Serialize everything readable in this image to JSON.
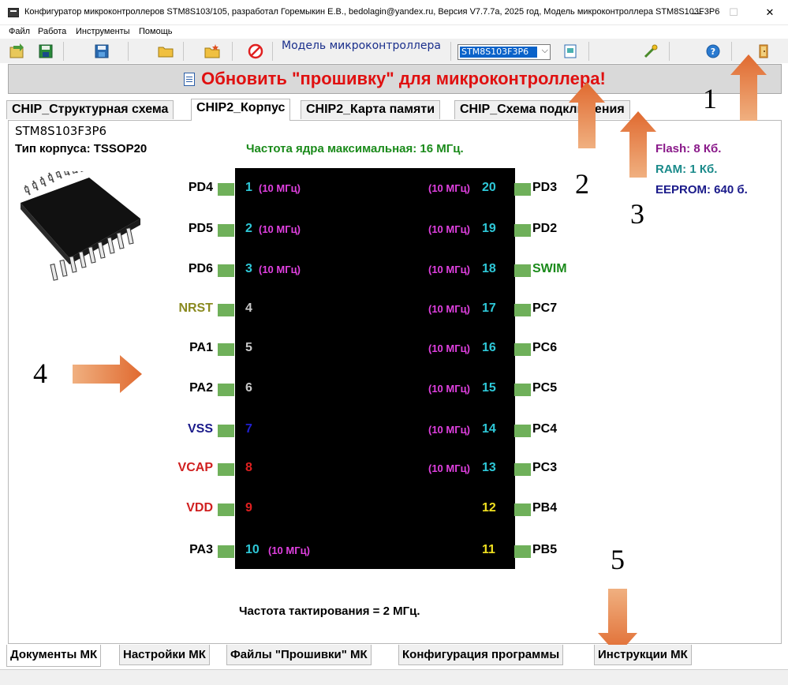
{
  "window": {
    "title": "Конфигуратор микроконтроллеров STM8S103/105, разработал Горемыкин Е.В., bedolagin@yandex.ru, Версия V7.7.7а, 2025 год, Модель микроконтроллера STM8S103F3P6",
    "minimize": "—",
    "maximize": "☐",
    "close": "✕"
  },
  "menu": [
    "Файл",
    "Работа",
    "Инструменты",
    "Помощь"
  ],
  "toolbar": {
    "model_label": "Модель микроконтроллера",
    "model_value": "STM8S103F3P6",
    "model_arrow": "⌵"
  },
  "update_button": "Обновить \"прошивку\" для микроконтроллера!",
  "tabs": [
    "CHIP_Структурная схема",
    "CHIP2_Корпус",
    "CHIP2_Карта памяти",
    "CHIP_Схема подключения"
  ],
  "chip": {
    "name": "STM8S103F3P6",
    "package": "Тип корпуса: TSSOP20",
    "core_freq": "Частота ядра максимальная: 16 МГц.",
    "flash": "Flash: 8 Кб.",
    "ram": "RAM: 1 Кб.",
    "eeprom": "EEPROM: 640 б.",
    "clock": "Частота тактирования = 2 МГц."
  },
  "pins_left": [
    {
      "label": "PD4",
      "num": "1",
      "freq": "(10 МГц)",
      "label_color": "#000000",
      "num_color": "#2ec8d8"
    },
    {
      "label": "PD5",
      "num": "2",
      "freq": "(10 МГц)",
      "label_color": "#000000",
      "num_color": "#2ec8d8"
    },
    {
      "label": "PD6",
      "num": "3",
      "freq": "(10 МГц)",
      "label_color": "#000000",
      "num_color": "#2ec8d8"
    },
    {
      "label": "NRST",
      "num": "4",
      "freq": "",
      "label_color": "#8a8a20",
      "num_color": "#c8c8c8"
    },
    {
      "label": "PA1",
      "num": "5",
      "freq": "",
      "label_color": "#000000",
      "num_color": "#c8c8c8"
    },
    {
      "label": "PA2",
      "num": "6",
      "freq": "",
      "label_color": "#000000",
      "num_color": "#c8c8c8"
    },
    {
      "label": "VSS",
      "num": "7",
      "freq": "",
      "label_color": "#1a1a8a",
      "num_color": "#2020d0"
    },
    {
      "label": "VCAP",
      "num": "8",
      "freq": "",
      "label_color": "#d02020",
      "num_color": "#e02020"
    },
    {
      "label": "VDD",
      "num": "9",
      "freq": "",
      "label_color": "#d02020",
      "num_color": "#e02020"
    },
    {
      "label": "PA3",
      "num": "10",
      "freq": "(10 МГц)",
      "label_color": "#000000",
      "num_color": "#2ec8d8"
    }
  ],
  "pins_right": [
    {
      "label": "PD3",
      "num": "20",
      "freq": "(10 МГц)",
      "label_color": "#000000",
      "num_color": "#2ec8d8"
    },
    {
      "label": "PD2",
      "num": "19",
      "freq": "(10 МГц)",
      "label_color": "#000000",
      "num_color": "#2ec8d8"
    },
    {
      "label": "SWIM",
      "num": "18",
      "freq": "(10 МГц)",
      "label_color": "#1a8a1a",
      "num_color": "#2ec8d8"
    },
    {
      "label": "PC7",
      "num": "17",
      "freq": "(10 МГц)",
      "label_color": "#000000",
      "num_color": "#2ec8d8"
    },
    {
      "label": "PC6",
      "num": "16",
      "freq": "(10 МГц)",
      "label_color": "#000000",
      "num_color": "#2ec8d8"
    },
    {
      "label": "PC5",
      "num": "15",
      "freq": "(10 МГц)",
      "label_color": "#000000",
      "num_color": "#2ec8d8"
    },
    {
      "label": "PC4",
      "num": "14",
      "freq": "(10 МГц)",
      "label_color": "#000000",
      "num_color": "#2ec8d8"
    },
    {
      "label": "PC3",
      "num": "13",
      "freq": "(10 МГц)",
      "label_color": "#000000",
      "num_color": "#2ec8d8"
    },
    {
      "label": "PB4",
      "num": "12",
      "freq": "",
      "label_color": "#000000",
      "num_color": "#f0e020"
    },
    {
      "label": "PB5",
      "num": "11",
      "freq": "",
      "label_color": "#000000",
      "num_color": "#f0e020"
    }
  ],
  "annotations": [
    "1",
    "2",
    "3",
    "4",
    "5"
  ],
  "bottom_tabs": [
    "Документы МК",
    "Настройки МК",
    "Файлы \"Прошивки\" МК",
    "Конфигурация программы",
    "Инструкции МК"
  ],
  "colors": {
    "arrow": "#e8824a",
    "update_text": "#e01010",
    "chip_body": "#000000",
    "pin_pad": "#6fb05a",
    "freq_text": "#e040e0"
  }
}
